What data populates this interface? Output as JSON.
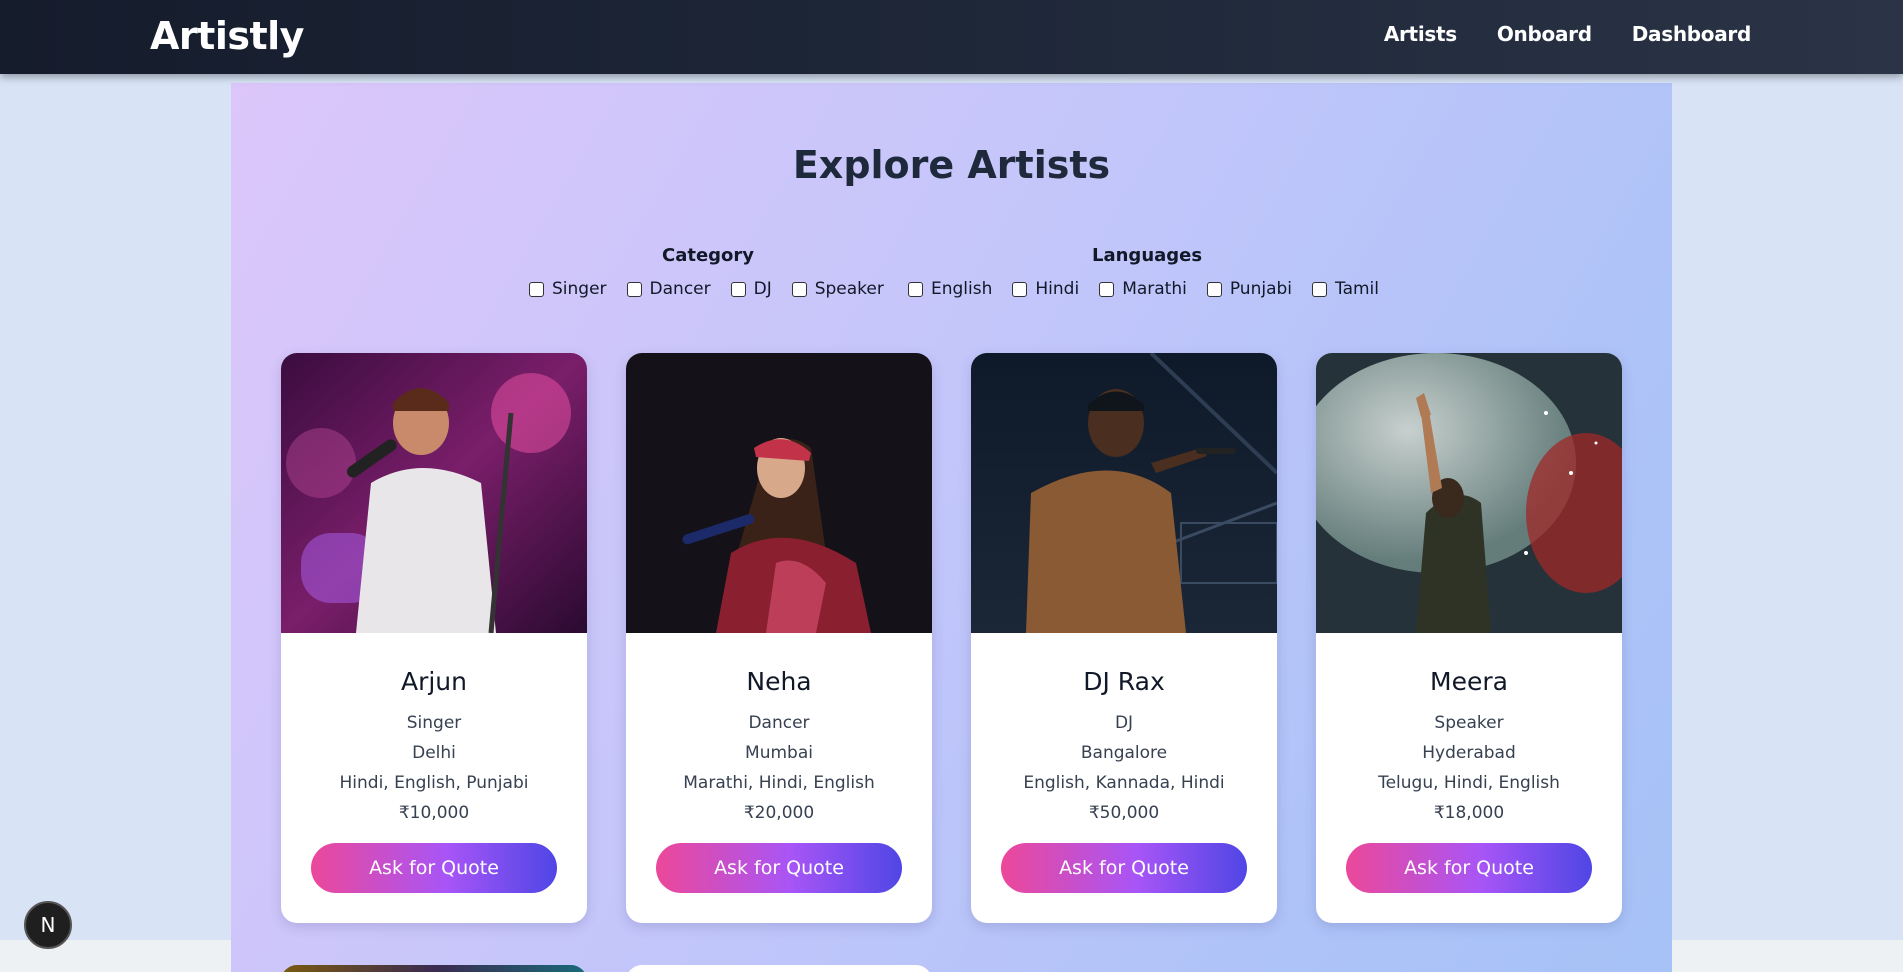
{
  "brand": "Artistly",
  "nav": [
    {
      "label": "Artists"
    },
    {
      "label": "Onboard"
    },
    {
      "label": "Dashboard"
    }
  ],
  "page_title": "Explore Artists",
  "filters": {
    "category_label": "Category",
    "categories": [
      "Singer",
      "Dancer",
      "DJ",
      "Speaker"
    ],
    "languages_label": "Languages",
    "languages": [
      "English",
      "Hindi",
      "Marathi",
      "Punjabi",
      "Tamil"
    ]
  },
  "artists": [
    {
      "name": "Arjun",
      "category": "Singer",
      "location": "Delhi",
      "languages": "Hindi, English, Punjabi",
      "price": "₹10,000",
      "button": "Ask for Quote"
    },
    {
      "name": "Neha",
      "category": "Dancer",
      "location": "Mumbai",
      "languages": "Marathi, Hindi, English",
      "price": "₹20,000",
      "button": "Ask for Quote"
    },
    {
      "name": "DJ Rax",
      "category": "DJ",
      "location": "Bangalore",
      "languages": "English, Kannada, Hindi",
      "price": "₹50,000",
      "button": "Ask for Quote"
    },
    {
      "name": "Meera",
      "category": "Speaker",
      "location": "Hyderabad",
      "languages": "Telugu, Hindi, English",
      "price": "₹18,000",
      "button": "Ask for Quote"
    }
  ],
  "fab_label": "N",
  "colors": {
    "navbar": "#1e2738",
    "button_start": "#ec4899",
    "button_end": "#4f46e5",
    "title": "#1e293b"
  }
}
